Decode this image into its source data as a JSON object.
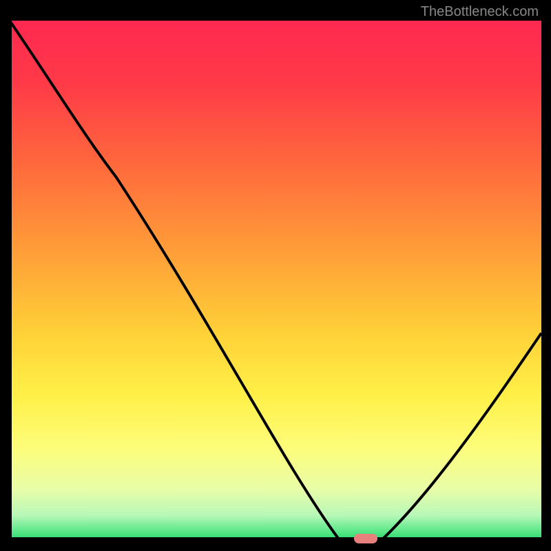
{
  "watermark": "TheBottleneck.com",
  "chart_data": {
    "type": "line",
    "title": "",
    "xlabel": "",
    "ylabel": "",
    "xlim": [
      0,
      100
    ],
    "ylim": [
      0,
      100
    ],
    "curve_points": [
      {
        "x": 0,
        "y": 100
      },
      {
        "x": 20,
        "y": 70
      },
      {
        "x": 62,
        "y": 0
      },
      {
        "x": 70,
        "y": 0
      },
      {
        "x": 100,
        "y": 40
      }
    ],
    "marker": {
      "x": 67,
      "y": 0
    },
    "gradient_stops": [
      {
        "offset": 0,
        "color": "#ff2850"
      },
      {
        "offset": 0.12,
        "color": "#ff3a48"
      },
      {
        "offset": 0.28,
        "color": "#ff6a3c"
      },
      {
        "offset": 0.45,
        "color": "#ffa038"
      },
      {
        "offset": 0.6,
        "color": "#ffd138"
      },
      {
        "offset": 0.72,
        "color": "#fff048"
      },
      {
        "offset": 0.82,
        "color": "#fdfd7a"
      },
      {
        "offset": 0.9,
        "color": "#e8fda8"
      },
      {
        "offset": 0.95,
        "color": "#b8f8b8"
      },
      {
        "offset": 0.98,
        "color": "#5ce88a"
      },
      {
        "offset": 1.0,
        "color": "#20d868"
      }
    ]
  }
}
